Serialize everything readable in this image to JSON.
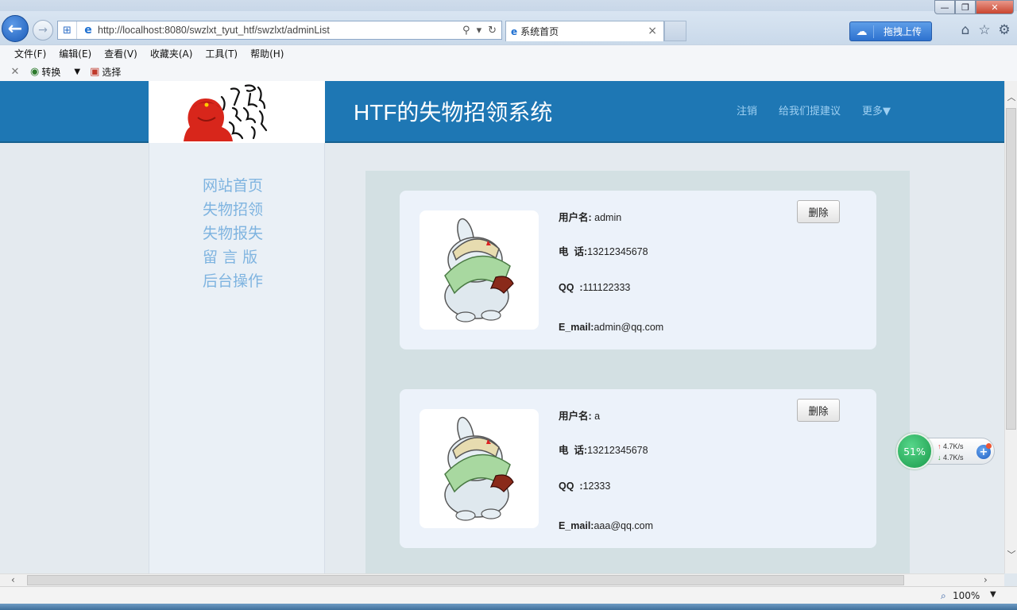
{
  "browser": {
    "url": "http://localhost:8080/swzlxt_tyut_htf/swzlxt/adminList",
    "tab_title": "系统首页",
    "upload_label": "拖拽上传",
    "window_controls": {
      "minimize": "—",
      "maximize": "❐",
      "close": "✕"
    },
    "menu": [
      "文件(F)",
      "编辑(E)",
      "查看(V)",
      "收藏夹(A)",
      "工具(T)",
      "帮助(H)"
    ],
    "commands": {
      "convert": "转换",
      "select": "选择"
    },
    "zoom": "100%"
  },
  "site": {
    "title": "HTF的失物招领系统",
    "nav": {
      "logout": "注销",
      "suggest": "给我们提建议",
      "more": "更多▼"
    },
    "sidebar": [
      {
        "label": "网站首页"
      },
      {
        "label": "失物招领"
      },
      {
        "label": "失物报失"
      },
      {
        "label": "留 言 版"
      },
      {
        "label": "后台操作"
      }
    ]
  },
  "users": [
    {
      "username_label": "用户名:",
      "username": " admin",
      "phone_label": "电  话:",
      "phone": "13212345678",
      "qq_label": "QQ  :",
      "qq": "111122333",
      "email_label": "E_mail:",
      "email": "admin@qq.com",
      "delete_label": "删除"
    },
    {
      "username_label": "用户名:",
      "username": " a",
      "phone_label": "电  话:",
      "phone": "13212345678",
      "qq_label": "QQ  :",
      "qq": "12333",
      "email_label": "E_mail:",
      "email": "aaa@qq.com",
      "delete_label": "删除"
    }
  ],
  "speed_widget": {
    "percent": "51%",
    "upload": "4.7K/s",
    "download": "4.7K/s"
  },
  "colors": {
    "header": "#1e77b4",
    "sidebar_link": "#7fb4e0",
    "nav_link": "#9fd0f2",
    "panel": "#d3e0e3",
    "card": "#ecf2fa"
  }
}
